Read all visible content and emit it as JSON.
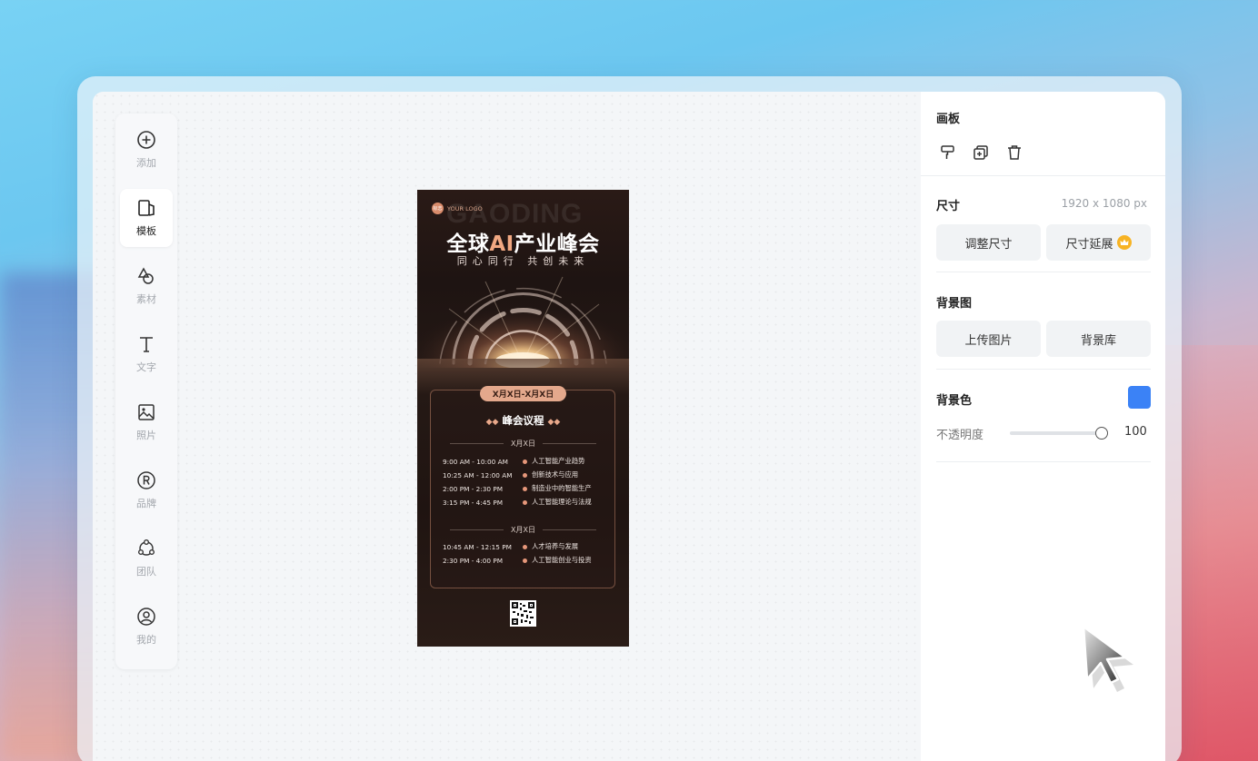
{
  "sidebar": {
    "items": [
      {
        "label": "添加",
        "icon": "plus-circle-icon"
      },
      {
        "label": "模板",
        "icon": "template-icon",
        "active": true
      },
      {
        "label": "素材",
        "icon": "shapes-icon"
      },
      {
        "label": "文字",
        "icon": "text-icon"
      },
      {
        "label": "照片",
        "icon": "image-icon"
      },
      {
        "label": "品牌",
        "icon": "registered-icon"
      },
      {
        "label": "团队",
        "icon": "team-icon"
      },
      {
        "label": "我的",
        "icon": "user-circle-icon"
      }
    ]
  },
  "poster": {
    "bg_text": "GAODING",
    "logo_badge": "标志",
    "logo_text": "YOUR LOGO",
    "title_prefix": "全球",
    "title_ai": "AI",
    "title_suffix": "产业峰会",
    "subtitle": "同心同行 共创未来",
    "date_range": "X月X日-X月X日",
    "agenda_title": "峰会议程",
    "days": [
      {
        "label": "X月X日",
        "sessions": [
          {
            "time": "9:00 AM - 10:00 AM",
            "topic": "人工智能产业趋势"
          },
          {
            "time": "10:25 AM - 12:00 AM",
            "topic": "创新技术与应用"
          },
          {
            "time": "2:00 PM - 2:30 PM",
            "topic": "制造业中的智能生产"
          },
          {
            "time": "3:15 PM - 4:45 PM",
            "topic": "人工智能理论与法规"
          }
        ]
      },
      {
        "label": "X月X日",
        "sessions": [
          {
            "time": "10:45 AM - 12:15 PM",
            "topic": "人才培养与发展"
          },
          {
            "time": "2:30 PM - 4:00 PM",
            "topic": "人工智能创业与投资"
          }
        ]
      }
    ]
  },
  "panel": {
    "canvas_title": "画板",
    "size_title": "尺寸",
    "size_value": "1920 x 1080 px",
    "resize_button": "调整尺寸",
    "extend_button": "尺寸延展",
    "bg_image_title": "背景图",
    "upload_button": "上传图片",
    "library_button": "背景库",
    "bg_color_title": "背景色",
    "bg_color": "#3b82f6",
    "opacity_label": "不透明度",
    "opacity_value": "100"
  },
  "colors": {
    "accent_orange": "#f1a882",
    "swatch_blue": "#3b82f6",
    "crown_gold": "#f7b324"
  }
}
